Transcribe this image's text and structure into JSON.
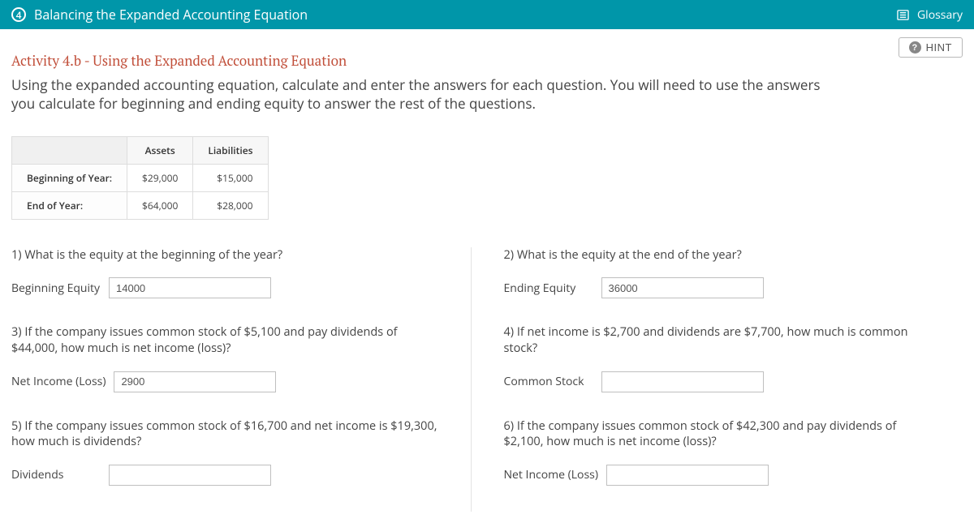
{
  "header": {
    "step": "4",
    "title": "Balancing the Expanded Accounting Equation",
    "glossary": "Glossary"
  },
  "hint": {
    "label": "HINT"
  },
  "activity": {
    "title": "Activity 4.b - Using the Expanded Accounting Equation",
    "instructions": "Using the expanded accounting equation, calculate and enter the answers for each question. You will need to use the answers you calculate for beginning and ending equity to answer the rest of the questions."
  },
  "table": {
    "col1": "Assets",
    "col2": "Liabilities",
    "rows": [
      {
        "label": "Beginning of Year:",
        "assets": "$29,000",
        "liab": "$15,000"
      },
      {
        "label": "End of Year:",
        "assets": "$64,000",
        "liab": "$28,000"
      }
    ]
  },
  "q1": {
    "text": "1) What is the equity at the beginning of the year?",
    "label": "Beginning Equity",
    "value": "14000"
  },
  "q2": {
    "text": "2) What is the equity at the end of the year?",
    "label": "Ending Equity",
    "value": "36000"
  },
  "q3": {
    "text": "3) If the company issues common stock of $5,100 and pay dividends of $44,000, how much is net income (loss)?",
    "label": "Net Income (Loss)",
    "value": "2900"
  },
  "q4": {
    "text": "4) If net income is $2,700 and dividends are $7,700, how much is common stock?",
    "label": "Common Stock",
    "value": ""
  },
  "q5": {
    "text": "5) If the company issues common stock of $16,700 and net income is $19,300, how much is dividends?",
    "label": "Dividends",
    "value": ""
  },
  "q6": {
    "text": "6) If the company issues common stock of $42,300 and pay dividends of $2,100, how much is net income (loss)?",
    "label": "Net Income (Loss)",
    "value": ""
  }
}
